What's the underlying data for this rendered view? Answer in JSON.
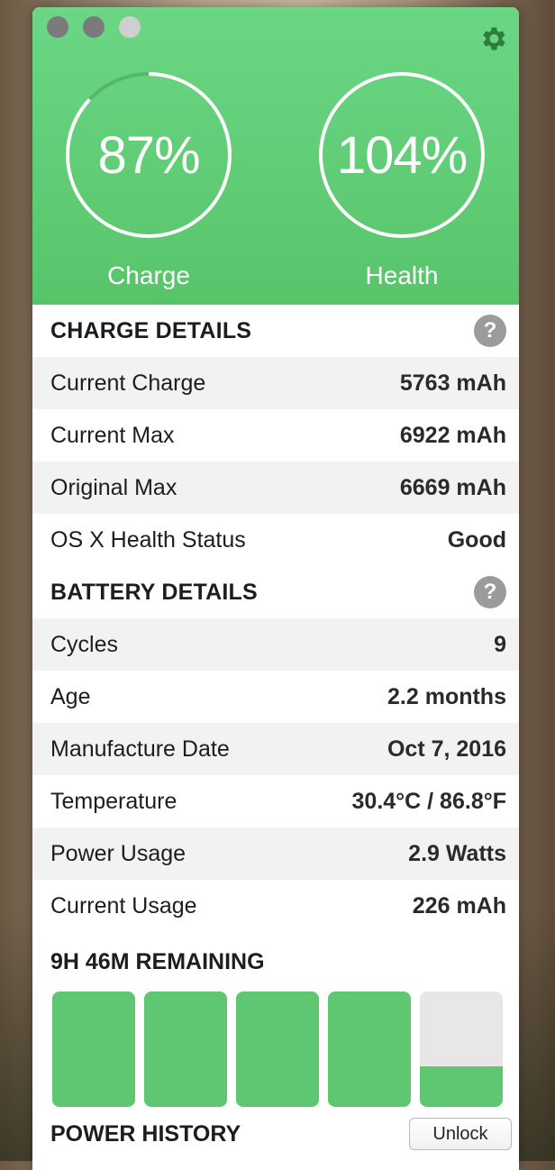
{
  "header": {
    "charge": {
      "value": "87%",
      "label": "Charge",
      "fraction": 0.87
    },
    "health": {
      "value": "104%",
      "label": "Health",
      "fraction": 1.0
    }
  },
  "charge_details": {
    "title": "CHARGE DETAILS",
    "help": "?",
    "rows": [
      {
        "label": "Current Charge",
        "value": "5763 mAh"
      },
      {
        "label": "Current Max",
        "value": "6922 mAh"
      },
      {
        "label": "Original Max",
        "value": "6669 mAh"
      },
      {
        "label": "OS X Health Status",
        "value": "Good"
      }
    ]
  },
  "battery_details": {
    "title": "BATTERY DETAILS",
    "help": "?",
    "rows": [
      {
        "label": "Cycles",
        "value": "9"
      },
      {
        "label": "Age",
        "value": "2.2 months"
      },
      {
        "label": "Manufacture Date",
        "value": "Oct 7, 2016"
      },
      {
        "label": "Temperature",
        "value": "30.4°C / 86.8°F"
      },
      {
        "label": "Power Usage",
        "value": "2.9 Watts"
      },
      {
        "label": "Current Usage",
        "value": "226 mAh"
      }
    ]
  },
  "remaining": {
    "title": "9H 46M REMAINING",
    "segments": [
      1.0,
      1.0,
      1.0,
      1.0,
      0.35
    ]
  },
  "power_history": {
    "title": "POWER HISTORY",
    "unlock_label": "Unlock"
  },
  "colors": {
    "accent": "#5fc771",
    "header": "#64d07a"
  }
}
